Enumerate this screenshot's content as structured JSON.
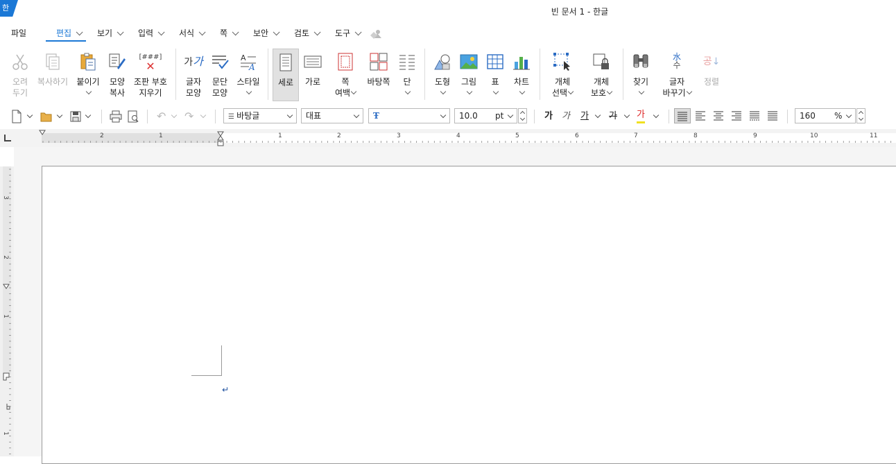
{
  "window": {
    "title": "빈 문서 1 - 한글",
    "app_badge": "한"
  },
  "menu": {
    "items": [
      {
        "label": "파일",
        "dropdown": false
      },
      {
        "label": "편집",
        "dropdown": true,
        "active": true
      },
      {
        "label": "보기",
        "dropdown": true
      },
      {
        "label": "입력",
        "dropdown": true
      },
      {
        "label": "서식",
        "dropdown": true
      },
      {
        "label": "쪽",
        "dropdown": true
      },
      {
        "label": "보안",
        "dropdown": true
      },
      {
        "label": "검토",
        "dropdown": true
      },
      {
        "label": "도구",
        "dropdown": true
      }
    ]
  },
  "ribbon": {
    "cut": {
      "l1": "오려",
      "l2": "두기"
    },
    "copy": {
      "l1": "복사하기"
    },
    "paste": {
      "l1": "붙이기"
    },
    "format_copy": {
      "l1": "모양",
      "l2": "복사"
    },
    "clear_marks": {
      "l1": "조판 부호",
      "l2": "지우기"
    },
    "char_shape": {
      "l1": "글자",
      "l2": "모양"
    },
    "para_shape": {
      "l1": "문단",
      "l2": "모양"
    },
    "style": {
      "l1": "스타일"
    },
    "portrait": {
      "l1": "세로"
    },
    "landscape": {
      "l1": "가로"
    },
    "margins": {
      "l1": "쪽",
      "l2": "여백"
    },
    "page_border": {
      "l1": "바탕쪽"
    },
    "columns": {
      "l1": "단"
    },
    "shapes": {
      "l1": "도형"
    },
    "picture": {
      "l1": "그림"
    },
    "table": {
      "l1": "표"
    },
    "chart": {
      "l1": "차트"
    },
    "select_object": {
      "l1": "개체",
      "l2": "선택"
    },
    "protect_object": {
      "l1": "개체",
      "l2": "보호"
    },
    "find": {
      "l1": "찾기"
    },
    "replace_char": {
      "l1": "글자",
      "l2": "바꾸기"
    },
    "sort": {
      "l1": "정렬"
    },
    "icon_text": {
      "clear_marks": "[###]",
      "char_shape": "가",
      "char_shape_accent": "가",
      "replace": "水",
      "replace_sub": "수",
      "sort": "공"
    }
  },
  "toolbar": {
    "style_combo": "바탕글",
    "lang_combo": "대표",
    "font_combo": "",
    "font_size": "10.0",
    "size_unit": "pt",
    "zoom": "160",
    "zoom_unit": "%",
    "fmt": {
      "bold": "가",
      "italic": "가",
      "underline": "가",
      "strike": "가",
      "color": "가"
    }
  },
  "ruler": {
    "h_labels": [
      "2",
      "1",
      "1",
      "2",
      "3",
      "4",
      "5",
      "6",
      "7",
      "8",
      "9",
      "10",
      "11"
    ],
    "v_labels": [
      "3",
      "2",
      "1",
      "1"
    ]
  },
  "document": {
    "paragraph_mark": "↵"
  },
  "colors": {
    "accent": "#1b78d6",
    "disabled": "#aaaaaa"
  }
}
